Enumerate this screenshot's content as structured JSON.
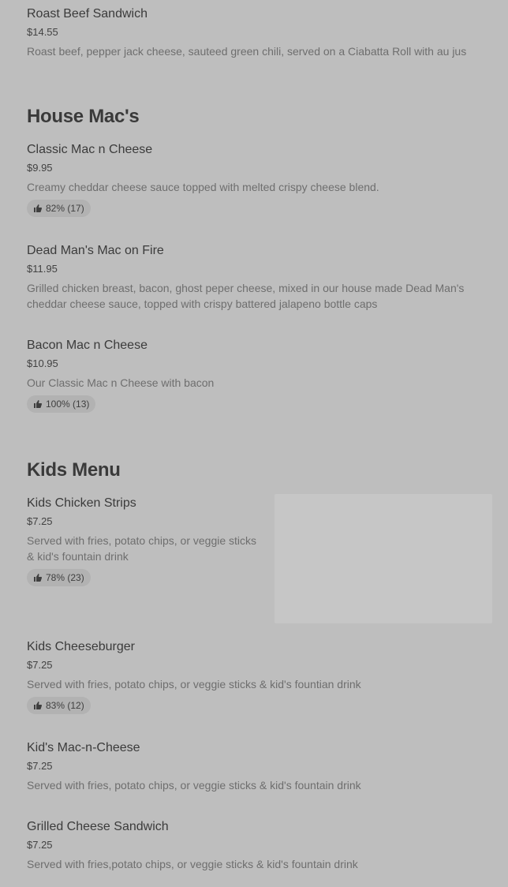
{
  "sections": [
    {
      "title": "",
      "items": [
        {
          "name": "Roast Beef Sandwich",
          "price": "$14.55",
          "description": "Roast beef, pepper jack cheese, sauteed green chili, served on a Ciabatta Roll with au jus"
        }
      ]
    },
    {
      "title": "House Mac's",
      "items": [
        {
          "name": "Classic Mac n Cheese",
          "price": "$9.95",
          "description": "Creamy cheddar cheese sauce topped with melted crispy cheese blend.",
          "rating": "82% (17)"
        },
        {
          "name": "Dead Man's Mac on Fire",
          "price": "$11.95",
          "description": "Grilled chicken breast, bacon, ghost peper cheese, mixed in our house made Dead Man's cheddar cheese sauce, topped with crispy battered jalapeno bottle caps"
        },
        {
          "name": "Bacon Mac n Cheese",
          "price": "$10.95",
          "description": "Our Classic Mac n Cheese with bacon",
          "rating": "100% (13)"
        }
      ]
    },
    {
      "title": "Kids Menu",
      "items": [
        {
          "name": "Kids Chicken Strips",
          "price": "$7.25",
          "description": "Served with fries, potato chips, or veggie sticks & kid's fountain drink",
          "rating": "78% (23)"
        },
        {
          "name": "Kids Cheeseburger",
          "price": "$7.25",
          "description": "Served with fries, potato chips, or veggie sticks & kid's fountian drink",
          "rating": "83% (12)"
        },
        {
          "name": "Kid's Mac-n-Cheese",
          "price": "$7.25",
          "description": "Served with fries, potato chips, or veggie sticks & kid's fountain drink"
        },
        {
          "name": "Grilled Cheese Sandwich",
          "price": "$7.25",
          "description": "Served with fries,potato chips, or veggie sticks & kid's fountain drink"
        }
      ]
    }
  ],
  "icons": {
    "rating": "thumbs-up-icon"
  },
  "colors": {
    "background": "#bebebe",
    "rating_pill": "#b2b2b2",
    "text_primary": "#3b3b3b",
    "text_secondary": "#6e6e6e"
  }
}
